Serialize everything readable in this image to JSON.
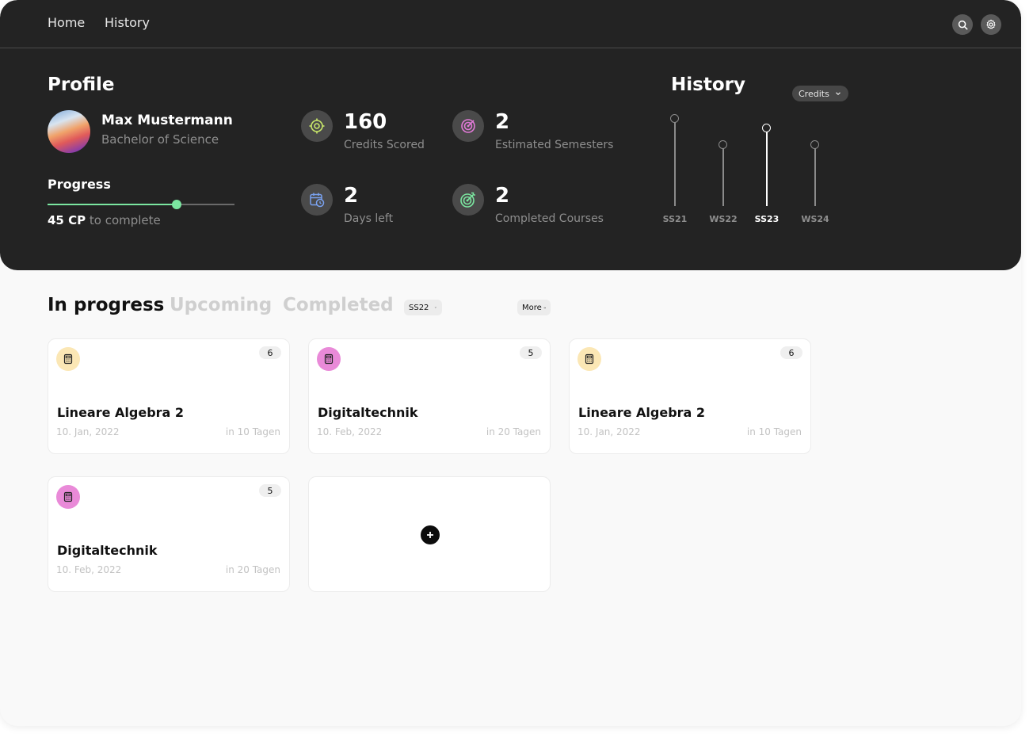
{
  "nav": {
    "home": "Home",
    "history": "History"
  },
  "profile": {
    "title": "Profile",
    "name": "Max Mustermann",
    "degree": "Bachelor of Science",
    "progress_title": "Progress",
    "progress_fraction": 0.69,
    "cp_value": "45 CP",
    "cp_suffix": " to complete"
  },
  "stats": [
    {
      "value": "160",
      "label": "Credits Scored",
      "icon": "target-icon",
      "color": "#c9e86a"
    },
    {
      "value": "2",
      "label": "Estimated Semesters",
      "icon": "bullseye-icon",
      "color": "#e27ad8"
    },
    {
      "value": "2",
      "label": "Days left",
      "icon": "calendar-clock-icon",
      "color": "#7aa2f0"
    },
    {
      "value": "2",
      "label": "Completed Courses",
      "icon": "bullseye-arrow-icon",
      "color": "#7be6a0"
    }
  ],
  "history": {
    "title": "History",
    "metric": "Credits",
    "chart_data": {
      "type": "bar",
      "categories": [
        "SS21",
        "WS22",
        "SS23",
        "WS24"
      ],
      "values": [
        100,
        70,
        89,
        70
      ],
      "active": "SS23",
      "ylim": [
        0,
        100
      ]
    }
  },
  "tabs": {
    "in_progress": "In progress",
    "upcoming": "Upcoming",
    "completed": "Completed"
  },
  "semester_filter": "SS22",
  "more_label": "More",
  "courses": [
    {
      "title": "Lineare Algebra 2",
      "date": "10. Jan, 2022",
      "due": "in 10 Tagen",
      "credits": "6",
      "icon": "calculator-icon",
      "color": "#fbe7b5"
    },
    {
      "title": "Digitaltechnik",
      "date": "10. Feb, 2022",
      "due": "in 20 Tagen",
      "credits": "5",
      "icon": "calculator-icon",
      "color": "#e98ad8"
    },
    {
      "title": "Lineare Algebra 2",
      "date": "10. Jan, 2022",
      "due": "in 10 Tagen",
      "credits": "6",
      "icon": "calculator-icon",
      "color": "#fbe7b5"
    },
    {
      "title": "Digitaltechnik",
      "date": "10. Feb, 2022",
      "due": "in 20 Tagen",
      "credits": "5",
      "icon": "calculator-icon",
      "color": "#e98ad8"
    }
  ],
  "add_icon": "plus-icon"
}
